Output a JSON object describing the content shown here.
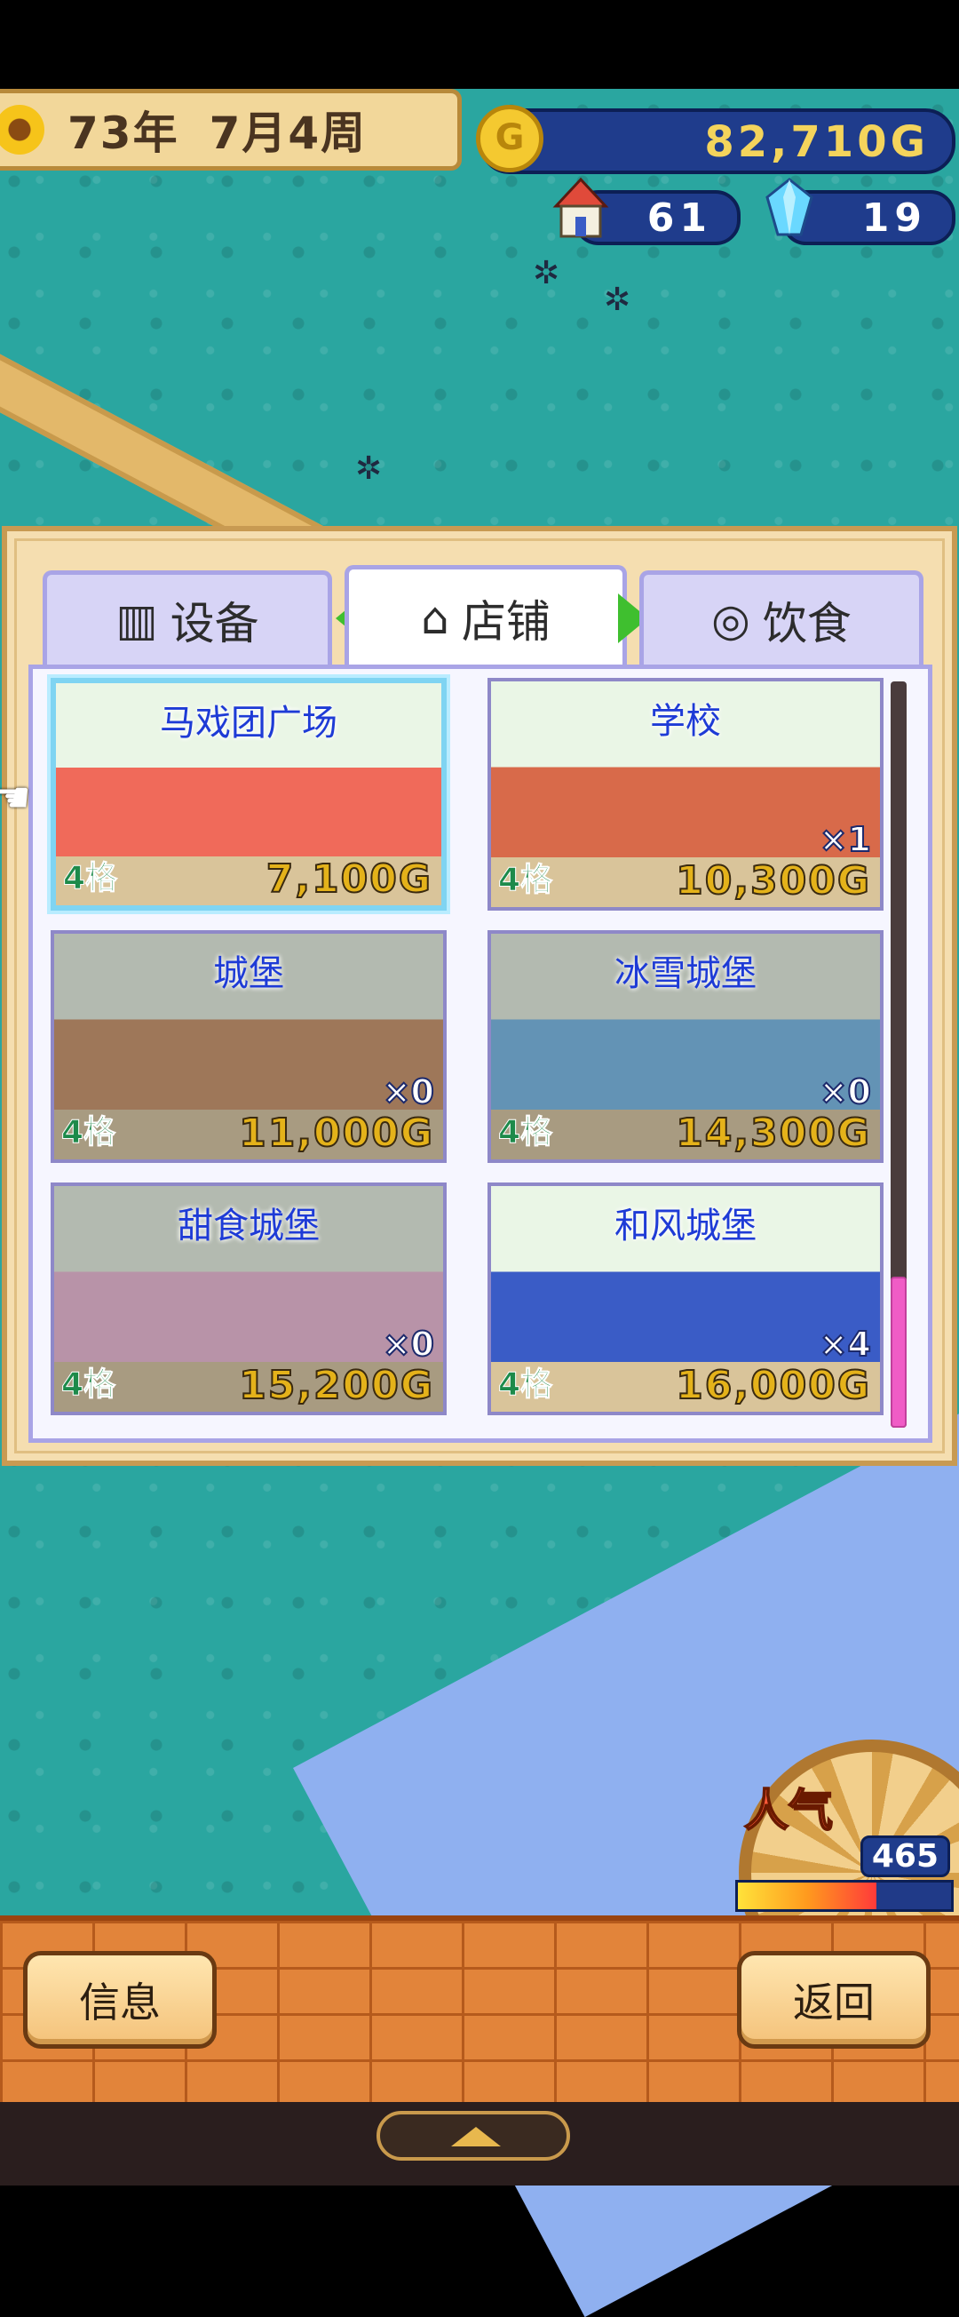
{
  "hud": {
    "year": "73年",
    "month_week": "7月4周",
    "coin_symbol": "G",
    "gold": "82,710G",
    "houses": "61",
    "crystals": "19"
  },
  "tabs": [
    {
      "label": "设备",
      "icon": "fence-icon",
      "active": false
    },
    {
      "label": "店铺",
      "icon": "shop-icon",
      "active": true
    },
    {
      "label": "饮食",
      "icon": "food-icon",
      "active": false
    }
  ],
  "cards": [
    {
      "title": "马戏团广场",
      "slots": "4格",
      "price": "7,100G",
      "owned": "",
      "selected": true,
      "dim": false,
      "color": "#f06a5a"
    },
    {
      "title": "学校",
      "slots": "4格",
      "price": "10,300G",
      "owned": "×1",
      "selected": false,
      "dim": false,
      "color": "#d86a4a"
    },
    {
      "title": "城堡",
      "slots": "4格",
      "price": "11,000G",
      "owned": "×0",
      "selected": false,
      "dim": true,
      "color": "#c98a5a"
    },
    {
      "title": "冰雪城堡",
      "slots": "4格",
      "price": "14,300G",
      "owned": "×0",
      "selected": false,
      "dim": true,
      "color": "#6ab6ee"
    },
    {
      "title": "甜食城堡",
      "slots": "4格",
      "price": "15,200G",
      "owned": "×0",
      "selected": false,
      "dim": true,
      "color": "#f2b6d8"
    },
    {
      "title": "和风城堡",
      "slots": "4格",
      "price": "16,000G",
      "owned": "×4",
      "selected": false,
      "dim": false,
      "color": "#3a5cc6"
    }
  ],
  "popularity": {
    "label": "人气",
    "value": "465",
    "fill": 0.65
  },
  "bottom": {
    "info_label": "信息",
    "back_label": "返回"
  }
}
